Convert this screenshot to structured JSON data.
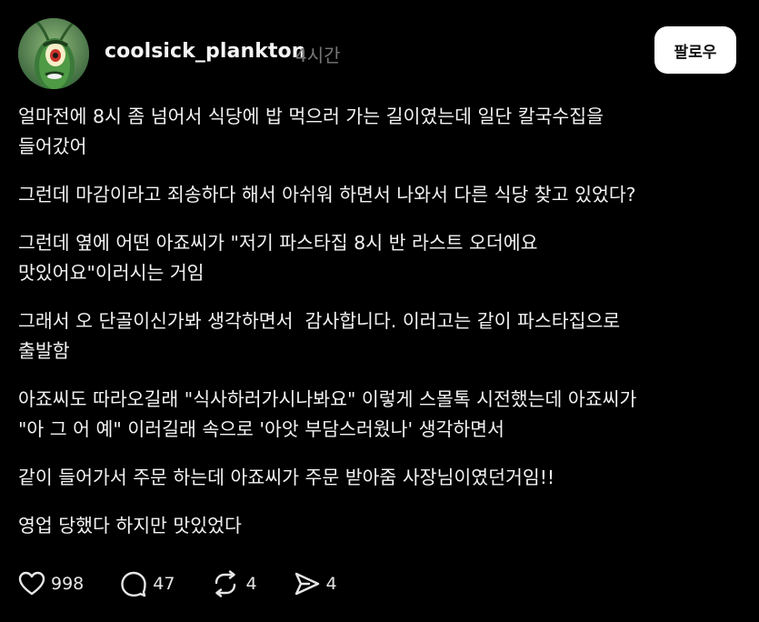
{
  "author": {
    "username": "coolsick_plankton",
    "time": "4시간",
    "avatar_icon": "plankton-avatar"
  },
  "follow_button": {
    "label": "팔로우"
  },
  "paragraphs": [
    "얼마전에 8시 좀 넘어서 식당에 밥 먹으러 가는 길이였는데 일단 칼국수집을\n들어갔어",
    "그런데 마감이라고 죄송하다 해서 아쉬워 하면서 나와서 다른 식당 찾고 있었다?",
    "그런데 옆에 어떤 아죠씨가 \"저기 파스타집 8시 반 라스트 오더에요\n맛있어요\"이러시는 거임",
    "그래서 오 단골이신가봐 생각하면서  감사합니다. 이러고는 같이 파스타집으로\n출발함",
    "아죠씨도 따라오길래 \"식사하러가시나봐요\" 이렇게 스몰톡 시전했는데 아죠씨가\n\"아 그 어 예\" 이러길래 속으로 '아앗 부담스러웠나' 생각하면서",
    "같이 들어가서 주문 하는데 아죠씨가 주문 받아줌 사장님이였던거임!!",
    "영업 당했다 하지만 맛있었다"
  ],
  "actions": {
    "like": {
      "icon": "heart-icon",
      "count": "998"
    },
    "comment": {
      "icon": "comment-bubble-icon",
      "count": "47"
    },
    "repost": {
      "icon": "repost-icon",
      "count": "4"
    },
    "share": {
      "icon": "send-icon",
      "count": "4"
    }
  },
  "colors": {
    "background": "#000000",
    "text": "#f3f3f3",
    "muted": "#777777",
    "button_bg": "#ffffff",
    "button_text": "#111111"
  }
}
